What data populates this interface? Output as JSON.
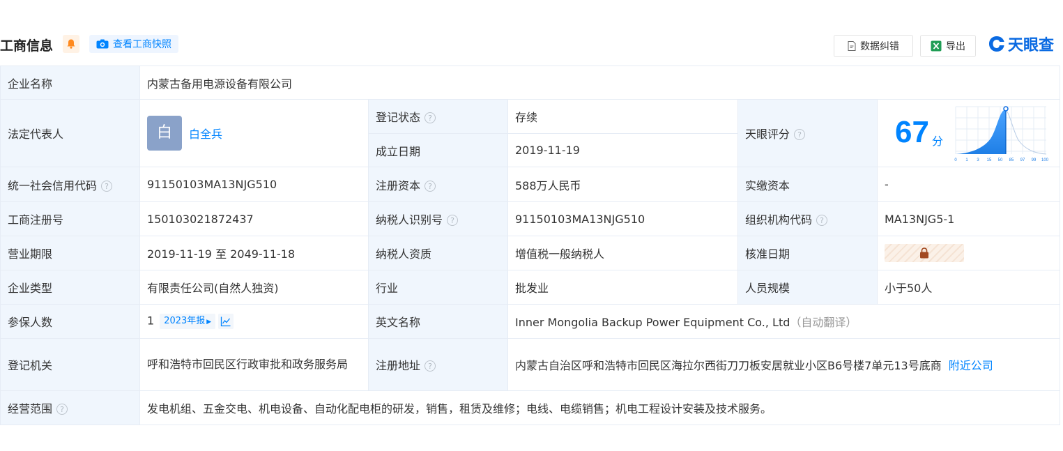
{
  "header": {
    "title": "工商信息",
    "snapshot_label": "查看工商快照",
    "correct_label": "数据纠错",
    "export_label": "导出",
    "brand": "天眼查"
  },
  "colors": {
    "accent": "#0084ff",
    "status_green": "#13a452",
    "key_bg": "#f0f6fd"
  },
  "rows": {
    "company_name": {
      "label": "企业名称",
      "value": "内蒙古备用电源设备有限公司"
    },
    "legal_rep": {
      "label": "法定代表人",
      "avatar_char": "白",
      "name": "白全兵"
    },
    "reg_status": {
      "label": "登记状态",
      "value": "存续"
    },
    "est_date": {
      "label": "成立日期",
      "value": "2019-11-19"
    },
    "score": {
      "label": "天眼评分",
      "value": "67",
      "unit": "分",
      "axis_ticks": [
        "0",
        "1",
        "3",
        "15",
        "50",
        "85",
        "97",
        "99",
        "100"
      ]
    },
    "credit_code": {
      "label": "统一社会信用代码",
      "value": "91150103MA13NJG510"
    },
    "reg_capital": {
      "label": "注册资本",
      "value": "588万人民币"
    },
    "paid_capital": {
      "label": "实缴资本",
      "value": "-"
    },
    "reg_number": {
      "label": "工商注册号",
      "value": "150103021872437"
    },
    "taxpayer_id": {
      "label": "纳税人识别号",
      "value": "91150103MA13NJG510"
    },
    "org_code": {
      "label": "组织机构代码",
      "value": "MA13NJG5-1"
    },
    "biz_term": {
      "label": "营业期限",
      "value": "2019-11-19 至 2049-11-18"
    },
    "taxpayer_type": {
      "label": "纳税人资质",
      "value": "增值税一般纳税人"
    },
    "approve_date": {
      "label": "核准日期",
      "locked_icon": "lock-icon"
    },
    "company_type": {
      "label": "企业类型",
      "value": "有限责任公司(自然人独资)"
    },
    "industry": {
      "label": "行业",
      "value": "批发业"
    },
    "staff_size": {
      "label": "人员规模",
      "value": "小于50人"
    },
    "insured": {
      "label": "参保人数",
      "value": "1",
      "report": "2023年报"
    },
    "english_name": {
      "label": "英文名称",
      "value": "Inner Mongolia Backup Power Equipment Co., Ltd",
      "note": "（自动翻译）"
    },
    "reg_authority": {
      "label": "登记机关",
      "value": "呼和浩特市回民区行政审批和政务服务局"
    },
    "reg_address": {
      "label": "注册地址",
      "value": "内蒙古自治区呼和浩特市回民区海拉尔西街刀刀板安居就业小区B6号楼7单元13号底商",
      "nearby": "附近公司"
    },
    "biz_scope": {
      "label": "经营范围",
      "value": "发电机组、五金交电、机电设备、自动化配电柜的研发，销售，租赁及维修；电线、电缆销售；机电工程设计安装及技术服务。"
    }
  }
}
